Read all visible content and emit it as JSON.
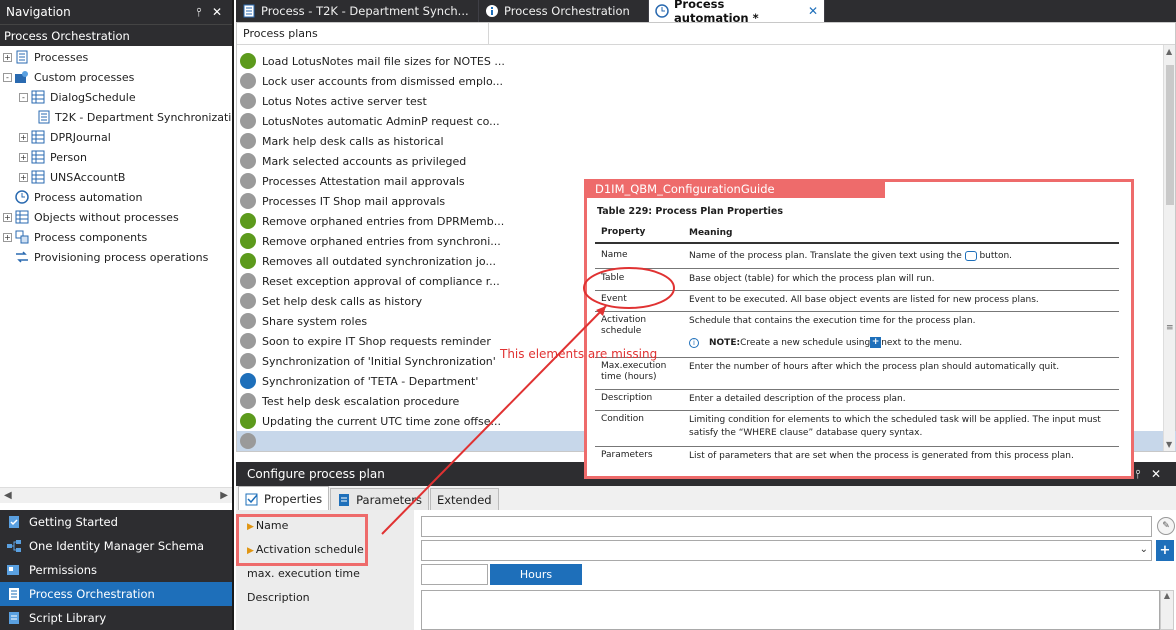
{
  "navigation": {
    "title": "Navigation",
    "pin": "⫯",
    "close": "✕",
    "section_title": "Process Orchestration",
    "tree": [
      {
        "label": "Processes",
        "indent": 0,
        "expander": "+",
        "icon": "process-icon"
      },
      {
        "label": "Custom processes",
        "indent": 0,
        "expander": "-",
        "icon": "custom-process-icon"
      },
      {
        "label": "DialogSchedule",
        "indent": 1,
        "expander": "-",
        "icon": "table-icon"
      },
      {
        "label": "T2K - Department Synchronization",
        "indent": 2,
        "expander": "",
        "icon": "process-icon"
      },
      {
        "label": "DPRJournal",
        "indent": 1,
        "expander": "+",
        "icon": "table-icon"
      },
      {
        "label": "Person",
        "indent": 1,
        "expander": "+",
        "icon": "table-icon"
      },
      {
        "label": "UNSAccountB",
        "indent": 1,
        "expander": "+",
        "icon": "table-icon"
      },
      {
        "label": "Process automation",
        "indent": 0,
        "expander": "",
        "icon": "clock-icon"
      },
      {
        "label": "Objects without processes",
        "indent": 0,
        "expander": "+",
        "icon": "table-icon"
      },
      {
        "label": "Process components",
        "indent": 0,
        "expander": "+",
        "icon": "component-icon"
      },
      {
        "label": "Provisioning process operations",
        "indent": 0,
        "expander": "",
        "icon": "provisioning-icon"
      }
    ],
    "sections": [
      {
        "label": "Getting Started",
        "icon": "getting-started-icon",
        "active": false
      },
      {
        "label": "One Identity Manager Schema",
        "icon": "schema-icon",
        "active": false
      },
      {
        "label": "Permissions",
        "icon": "permissions-icon",
        "active": false
      },
      {
        "label": "Process Orchestration",
        "icon": "process-orchestration-icon",
        "active": true
      },
      {
        "label": "Script Library",
        "icon": "script-library-icon",
        "active": false
      }
    ]
  },
  "tabs": [
    {
      "label": "Process - T2K - Department Synch...",
      "icon": "process-icon",
      "active": false
    },
    {
      "label": "Process Orchestration",
      "icon": "info-icon",
      "active": false
    },
    {
      "label": "Process automation *",
      "icon": "clock-icon",
      "active": true
    }
  ],
  "tab_close": "✕",
  "plans": {
    "column_header": "Process plans",
    "rows": [
      {
        "label": "Load LotusNotes mail file sizes for NOTES ...",
        "status": "green"
      },
      {
        "label": "Lock user accounts from dismissed emplo...",
        "status": "gray"
      },
      {
        "label": "Lotus Notes active server test",
        "status": "gray"
      },
      {
        "label": "LotusNotes automatic AdminP request co...",
        "status": "gray"
      },
      {
        "label": "Mark help desk calls as historical",
        "status": "gray"
      },
      {
        "label": "Mark selected accounts as privileged",
        "status": "gray"
      },
      {
        "label": "Processes Attestation mail approvals",
        "status": "gray"
      },
      {
        "label": "Processes IT Shop mail approvals",
        "status": "gray"
      },
      {
        "label": "Remove orphaned entries from DPRMemb...",
        "status": "green"
      },
      {
        "label": "Remove orphaned entries from synchroni...",
        "status": "green"
      },
      {
        "label": "Removes all outdated synchronization jo...",
        "status": "green"
      },
      {
        "label": "Reset exception approval of compliance r...",
        "status": "gray"
      },
      {
        "label": "Set help desk calls as history",
        "status": "gray"
      },
      {
        "label": "Share system roles",
        "status": "gray"
      },
      {
        "label": "Soon to expire IT Shop requests reminder",
        "status": "gray"
      },
      {
        "label": "Synchronization of 'Initial Synchronization'",
        "status": "gray"
      },
      {
        "label": "Synchronization of 'TETA - Department'",
        "status": "blue"
      },
      {
        "label": "Test help desk escalation procedure",
        "status": "gray"
      },
      {
        "label": "Updating the current UTC time zone offse...",
        "status": "green"
      },
      {
        "label": "",
        "status": "gray",
        "selected": true
      }
    ]
  },
  "configure": {
    "title": "Configure process plan",
    "pin": "⫯",
    "close": "✕",
    "tabs": [
      {
        "label": "Properties",
        "icon": "properties-icon",
        "active": true
      },
      {
        "label": "Parameters",
        "icon": "parameters-icon",
        "active": false
      },
      {
        "label": "Extended",
        "icon": "",
        "active": false
      }
    ],
    "fields": {
      "name_label": "Name",
      "name_value": "",
      "activation_label": "Activation schedule",
      "activation_value": "",
      "max_exec_label": "max. execution time",
      "max_exec_value": "",
      "hours_label": "Hours",
      "description_label": "Description",
      "description_value": ""
    }
  },
  "doc_overlay": {
    "title": "D1IM_QBM_ConfigurationGuide",
    "caption": "Table 229: Process Plan Properties",
    "header": {
      "property": "Property",
      "meaning": "Meaning"
    },
    "rows": [
      {
        "property": "Name",
        "meaning_before": "Name of the process plan. Translate the given text using the ",
        "meaning_after": " button."
      },
      {
        "property": "Table",
        "meaning": "Base object (table) for which the process plan will run."
      },
      {
        "property": "Event",
        "meaning": "Event to be executed. All base object events are listed for new process plans."
      },
      {
        "property": "Activation schedule",
        "meaning": "Schedule that contains the execution time for the process plan."
      },
      {
        "property": "Max.execution time (hours)",
        "meaning": "Enter the number of hours after which the process plan should automatically quit."
      },
      {
        "property": "Description",
        "meaning": "Enter a detailed description of the process plan."
      },
      {
        "property": "Condition",
        "meaning": "Limiting condition for elements to which the scheduled task will be applied. The input must satisfy the “WHERE clause” database query syntax."
      },
      {
        "property": "Parameters",
        "meaning": "List of parameters that are set when the process is generated from this process plan."
      }
    ],
    "note_label": "NOTE:",
    "note_before": " Create a new schedule using ",
    "note_after": " next to the menu."
  },
  "annotation": {
    "text": "This elements are missing",
    "color": "#e03232"
  },
  "colors": {
    "dark_bar": "#2d2d30",
    "accent": "#1e6fba",
    "status_green": "#5c9a1c",
    "status_gray": "#9a9a9a",
    "status_blue": "#1e6fba",
    "highlight": "#ee6b6b"
  }
}
